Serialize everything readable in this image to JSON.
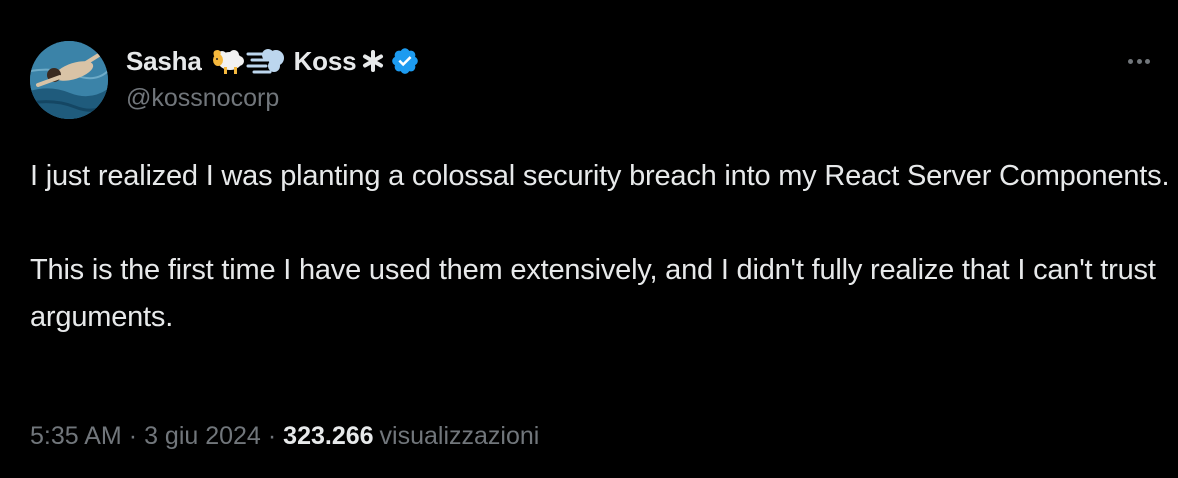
{
  "author": {
    "display_name_first": "Sasha",
    "display_name_last": "Koss",
    "handle": "@kossnocorp",
    "verified": true,
    "emoji_icons": [
      "ram-icon",
      "wind-icon",
      "asterisk-icon"
    ],
    "verified_color": "#1d9bf0"
  },
  "tweet": {
    "paragraphs": [
      "I just realized I was planting a colossal security breach into my React Server Components.",
      "This is the first time I have used them extensively, and I didn't fully realize that I can't trust arguments."
    ],
    "time": "5:35 AM",
    "date": "3 giu 2024",
    "separator": "·",
    "views_count": "323.266",
    "views_label": "visualizzazioni"
  },
  "colors": {
    "background": "#000000",
    "text_primary": "#e7e9ea",
    "text_secondary": "#71767b"
  },
  "more_icon": "more-dots-icon"
}
